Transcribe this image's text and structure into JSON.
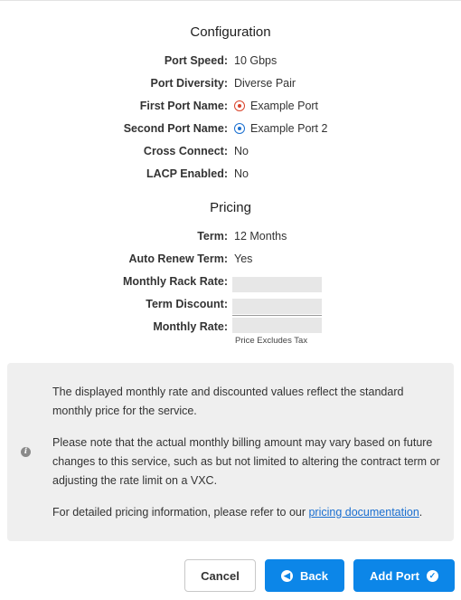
{
  "configuration": {
    "title": "Configuration",
    "rows": [
      {
        "label": "Port Speed:",
        "value": "10 Gbps"
      },
      {
        "label": "Port Diversity:",
        "value": "Diverse Pair"
      },
      {
        "label": "First Port Name:",
        "value": "Example Port",
        "indicator_color": "#d9432b"
      },
      {
        "label": "Second Port Name:",
        "value": "Example Port 2",
        "indicator_color": "#1a6fd0"
      },
      {
        "label": "Cross Connect:",
        "value": "No"
      },
      {
        "label": "LACP Enabled:",
        "value": "No"
      }
    ]
  },
  "pricing": {
    "title": "Pricing",
    "rows": [
      {
        "label": "Term:",
        "value": "12 Months"
      },
      {
        "label": "Auto Renew Term:",
        "value": "Yes"
      },
      {
        "label": "Monthly Rack Rate:",
        "value": ""
      },
      {
        "label": "Term Discount:",
        "value": ""
      },
      {
        "label": "Monthly Rate:",
        "value": ""
      }
    ],
    "tax_note": "Price Excludes Tax"
  },
  "info": {
    "icon": "info-icon",
    "paragraph1": "The displayed monthly rate and discounted values reflect the standard monthly price for the service.",
    "paragraph2": "Please note that the actual monthly billing amount may vary based on future changes to this service, such as but not limited to altering the contract term or adjusting the rate limit on a VXC.",
    "paragraph3_prefix": "For detailed pricing information, please refer to our ",
    "paragraph3_link": "pricing documentation",
    "paragraph3_suffix": "."
  },
  "actions": {
    "cancel_label": "Cancel",
    "back_label": "Back",
    "back_icon": "arrow-left-circle-icon",
    "add_label": "Add Port",
    "add_icon": "check-circle-icon"
  },
  "colors": {
    "primary": "#0c86e8",
    "panel_bg": "#efefef",
    "link": "#1a6fd0"
  }
}
